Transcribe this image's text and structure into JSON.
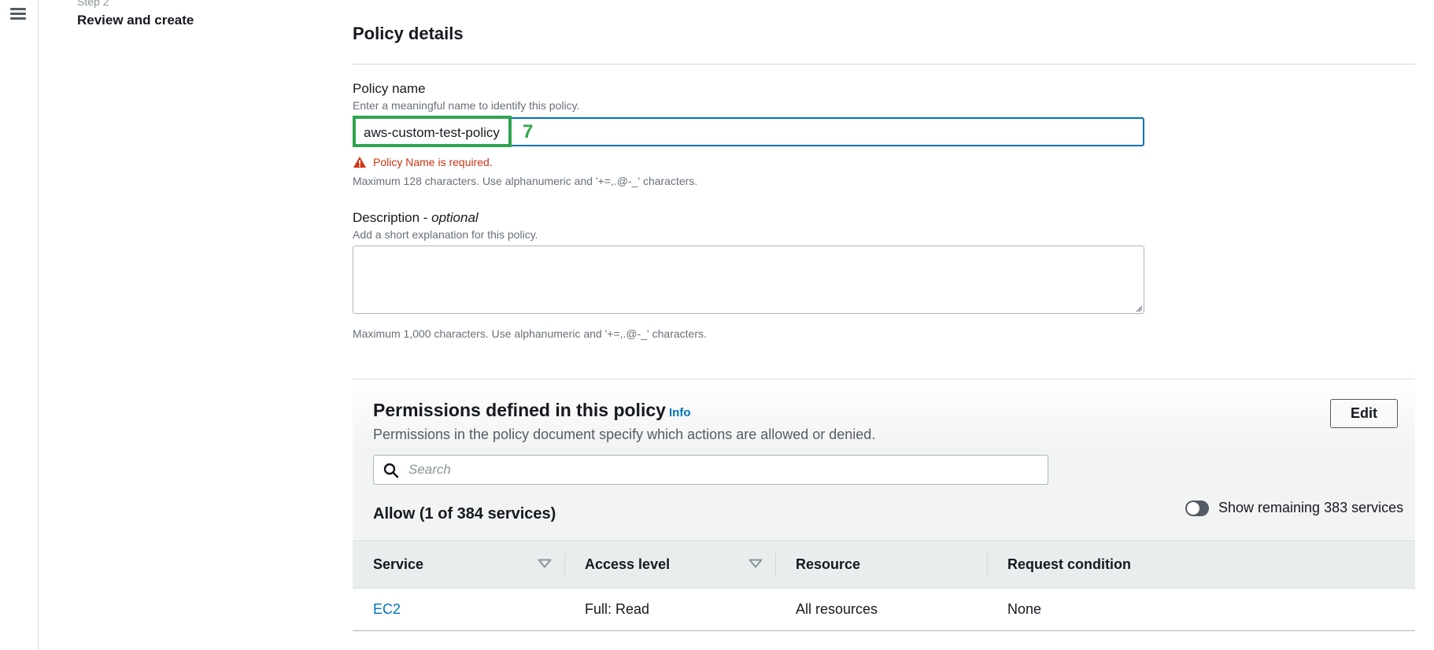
{
  "wizard": {
    "step_label": "Step 2",
    "step_title": "Review and create"
  },
  "policy_details": {
    "title": "Policy details",
    "name_label": "Policy name",
    "name_description": "Enter a meaningful name to identify this policy.",
    "name_value": "aws-custom-test-policy",
    "name_annotation": "7",
    "name_error": "Policy Name is required.",
    "name_constraint": "Maximum 128 characters. Use alphanumeric and '+=,.@-_' characters.",
    "description_label": "Description - ",
    "description_label_optional": "optional",
    "description_hint": "Add a short explanation for this policy.",
    "description_value": "",
    "description_constraint": "Maximum 1,000 characters. Use alphanumeric and '+=,.@-_' characters."
  },
  "permissions": {
    "title": "Permissions defined in this policy",
    "info_link": "Info",
    "description": "Permissions in the policy document specify which actions are allowed or denied.",
    "edit_button": "Edit",
    "search_placeholder": "Search",
    "allow_heading": "Allow (1 of 384 services)",
    "toggle_label": "Show remaining 383 services",
    "toggle_on": false,
    "columns": [
      "Service",
      "Access level",
      "Resource",
      "Request condition"
    ],
    "rows": [
      {
        "service": "EC2",
        "access_level": "Full: Read",
        "resource": "All resources",
        "request_condition": "None"
      }
    ]
  },
  "icons": {
    "menu": "hamburger-menu-icon",
    "error": "warning-triangle-icon",
    "search": "search-icon",
    "sort": "sort-caret-icon"
  },
  "colors": {
    "link": "#0073bb",
    "error": "#d13212",
    "highlight": "#2ea44f",
    "focus_border": "#0073bb"
  }
}
